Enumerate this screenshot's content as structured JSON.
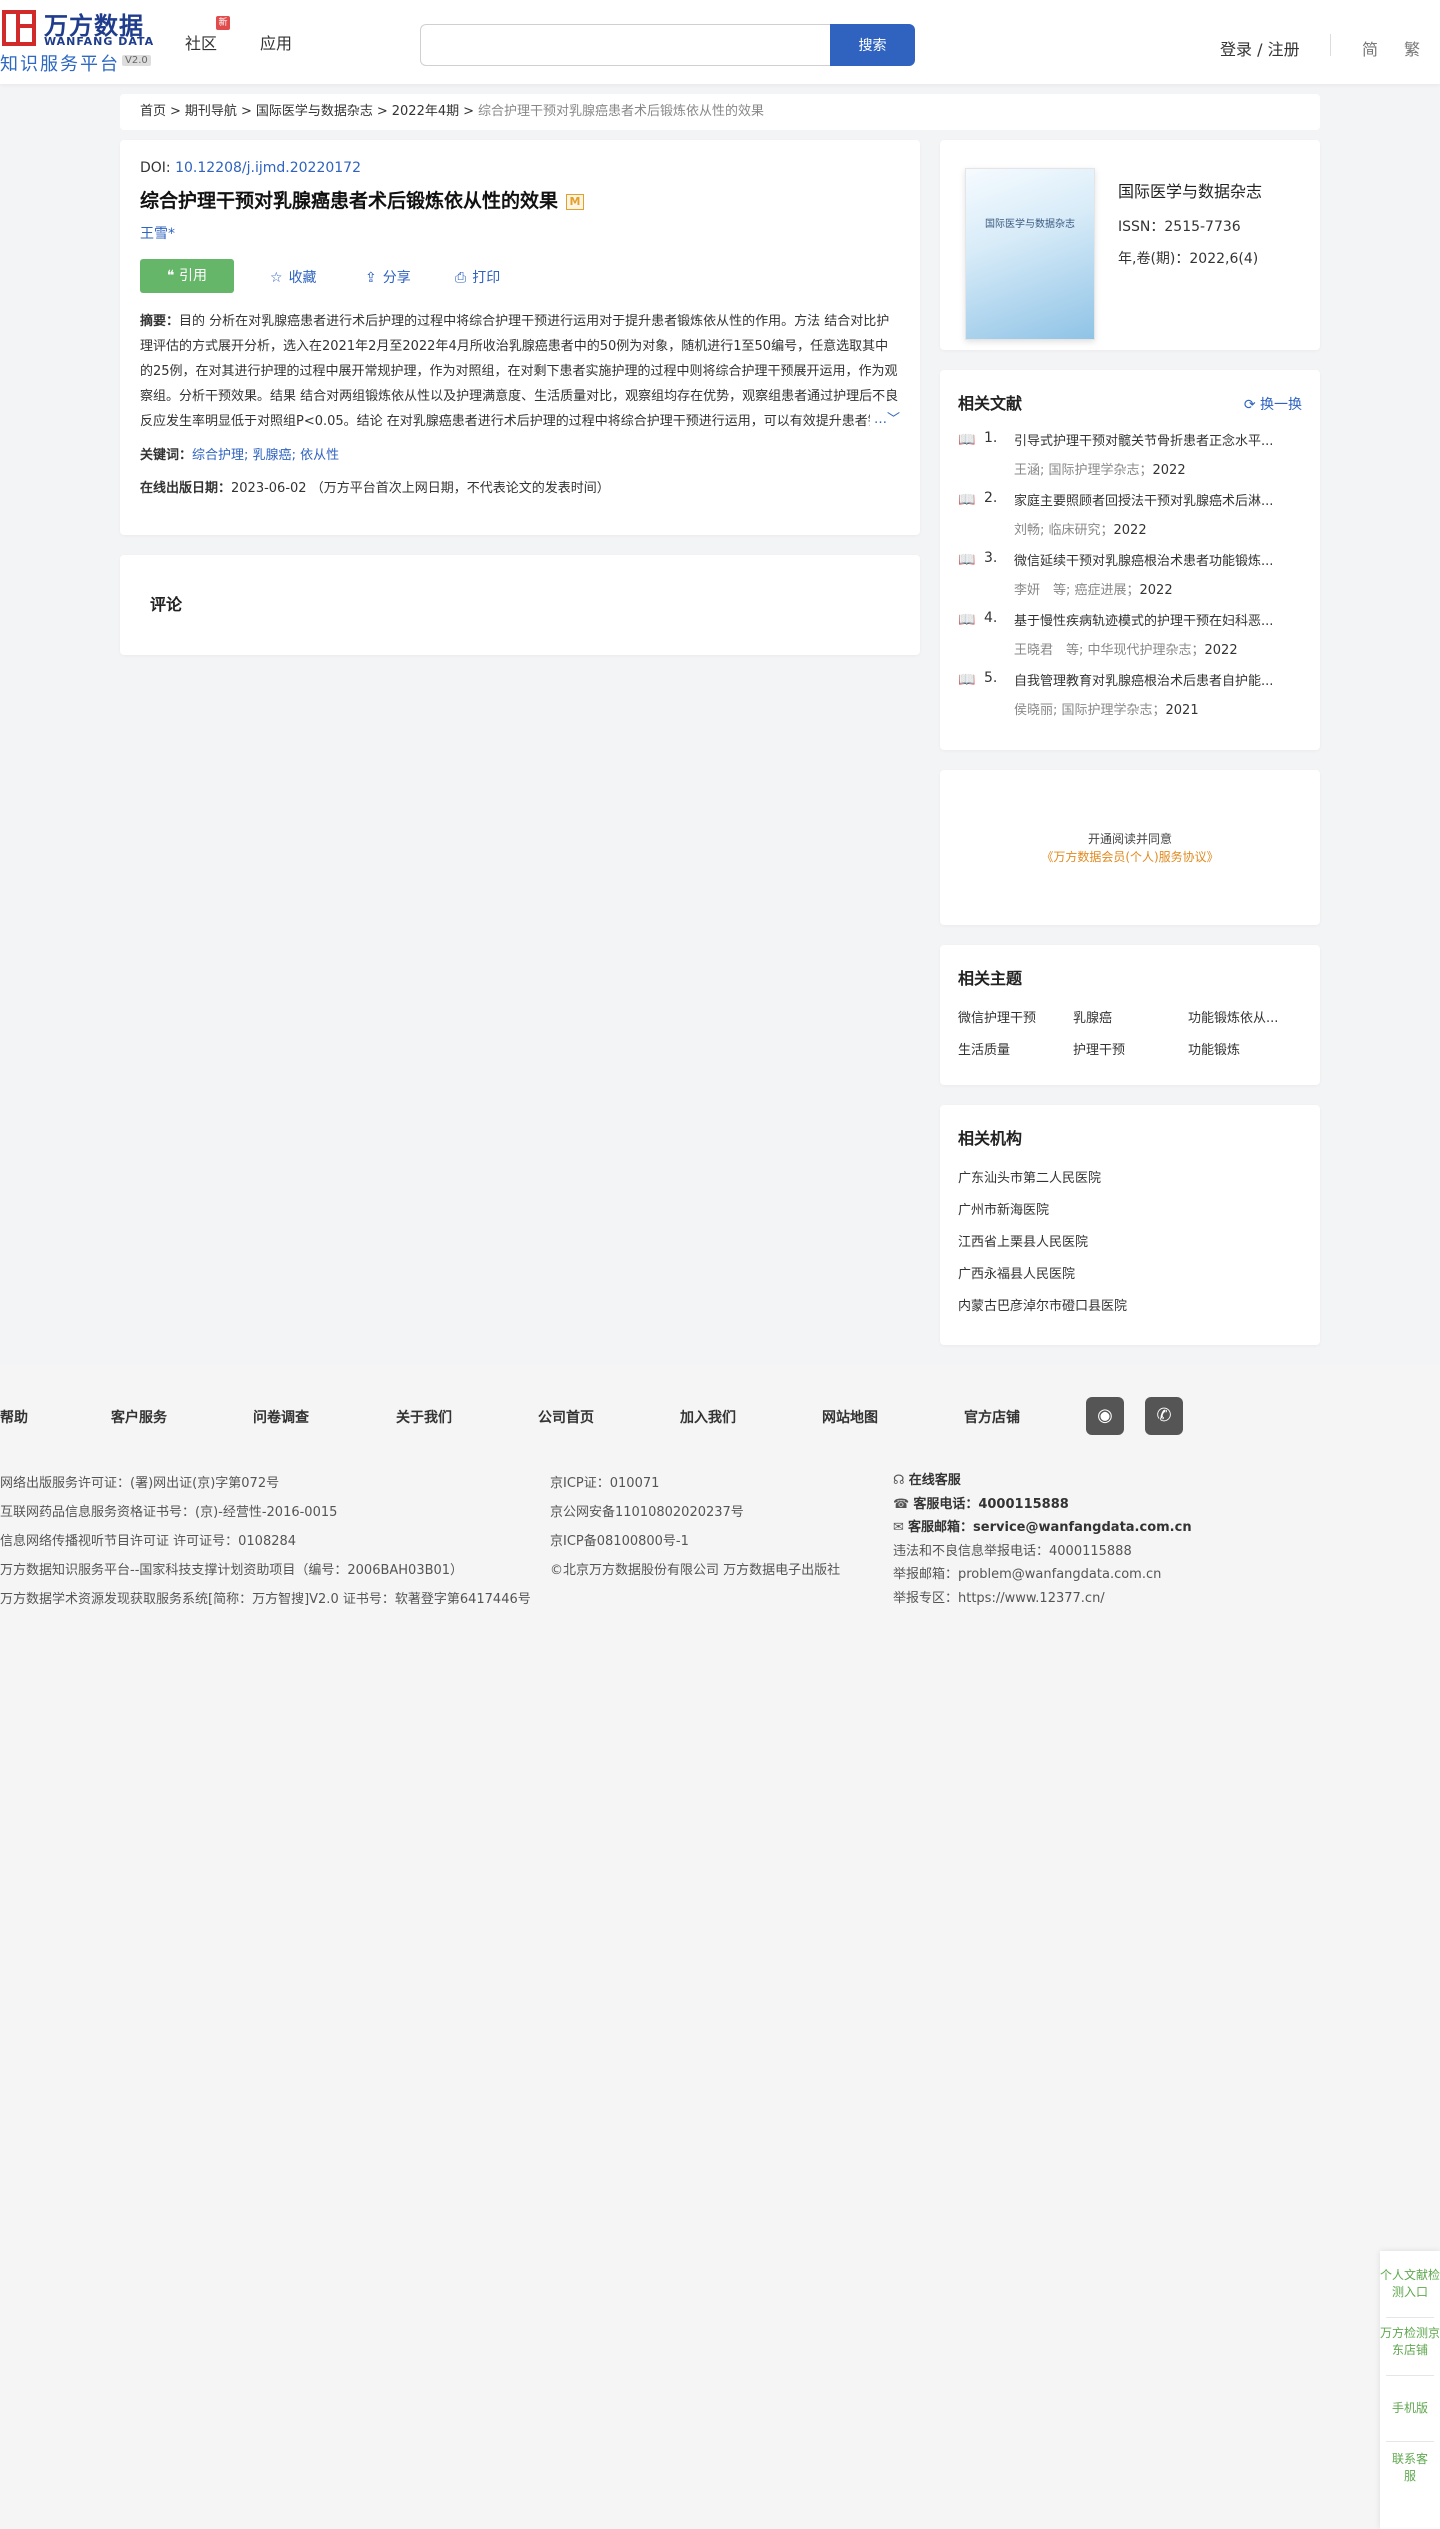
{
  "header": {
    "logo_cn": "万方数据",
    "logo_en": "WANFANG DATA",
    "logo_sub": "知识服务平台",
    "logo_ver": "V2.0",
    "nav": [
      "社区",
      "应用"
    ],
    "nav_badge": "新",
    "search_placeholder": "",
    "search_button": "搜索",
    "login": "登录 / 注册",
    "lang_simplified": "简",
    "lang_traditional": "繁"
  },
  "breadcrumb": {
    "items": [
      "首页",
      "期刊导航",
      "国际医学与数据杂志",
      "2022年4期"
    ],
    "current": "综合护理干预对乳腺癌患者术后锻炼依从性的效果",
    "sep": ">"
  },
  "article": {
    "doi_label": "DOI: ",
    "doi": "10.12208/j.ijmd.20220172",
    "title": "综合护理干预对乳腺癌患者术后锻炼依从性的效果",
    "badge": "M",
    "author": "王雪*",
    "actions": {
      "cite": "引用",
      "favorite": "收藏",
      "share": "分享",
      "print": "打印"
    },
    "abstract_label": "摘要：",
    "abstract": "目的 分析在对乳腺癌患者进行术后护理的过程中将综合护理干预进行运用对于提升患者锻炼依从性的作用。方法 结合对比护理评估的方式展开分析，选入在2021年2月至2022年4月所收治乳腺癌患者中的50例为对象，随机进行1至50编号，任意选取其中的25例，在对其进行护理的过程中展开常规护理，作为对照组，在对剩下患者实施护理的过程中则将综合护理干预展开运用，作为观察组。分析干预效果。结果 结合对两组锻炼依从性以及护理满意度、生活质量对比，观察组均存在优势，观察组患者通过护理后不良反应发生率明显低于对照组P<0.05。结论 在对乳腺癌患者进行术后护理的过程中将综合护理干预进行运用，可以有效提升患者锻炼依从性。",
    "keywords_label": "关键词：",
    "keywords": [
      "综合护理",
      "乳腺癌",
      "依从性"
    ],
    "pubdate_label": "在线出版日期：",
    "pubdate": "2023-06-02",
    "pubdate_note": "（万方平台首次上网日期，不代表论文的发表时间）"
  },
  "comment": {
    "title": "评论"
  },
  "journal": {
    "cover_title": "国际医学与数据杂志",
    "name": "国际医学与数据杂志",
    "issn": "ISSN：2515-7736",
    "volume": "年,卷(期)：2022,6(4)"
  },
  "related_literature": {
    "title": "相关文献",
    "refresh": "换一换",
    "items": [
      {
        "num": "1.",
        "title": "引导式护理干预对髋关节骨折患者正念水平...",
        "meta": "王涵; 国际护理学杂志；",
        "year": "2022"
      },
      {
        "num": "2.",
        "title": "家庭主要照顾者回授法干预对乳腺癌术后淋...",
        "meta": "刘畅; 临床研究；",
        "year": "2022"
      },
      {
        "num": "3.",
        "title": "微信延续干预对乳腺癌根治术患者功能锻炼...",
        "meta": "李妍　等; 癌症进展；",
        "year": "2022"
      },
      {
        "num": "4.",
        "title": "基于慢性疾病轨迹模式的护理干预在妇科恶...",
        "meta": "王晓君　等; 中华现代护理杂志；",
        "year": "2022"
      },
      {
        "num": "5.",
        "title": "自我管理教育对乳腺癌根治术后患者自护能...",
        "meta": "侯晓丽; 国际护理学杂志；",
        "year": "2021"
      }
    ]
  },
  "ad": {
    "line1": "开通阅读并同意",
    "line2": "《万方数据会员(个人)服务协议》"
  },
  "related_topics": {
    "title": "相关主题",
    "items": [
      "微信护理干预",
      "乳腺癌",
      "功能锻炼依从...",
      "生活质量",
      "护理干预",
      "功能锻炼"
    ]
  },
  "related_orgs": {
    "title": "相关机构",
    "items": [
      "广东汕头市第二人民医院",
      "广州市新海医院",
      "江西省上栗县人民医院",
      "广西永福县人民医院",
      "内蒙古巴彦淖尔市磴口县医院"
    ]
  },
  "footer": {
    "nav": [
      "帮助",
      "客户服务",
      "问卷调查",
      "关于我们",
      "公司首页",
      "加入我们",
      "网站地图",
      "官方店铺"
    ],
    "left": [
      "网络出版服务许可证：(署)网出证(京)字第072号",
      "互联网药品信息服务资格证书号：(京)-经营性-2016-0015",
      "信息网络传播视听节目许可证 许可证号：0108284",
      "万方数据知识服务平台--国家科技支撑计划资助项目（编号：2006BAH03B01）",
      "万方数据学术资源发现获取服务系统[简称：万方智搜]V2.0 证书号：软著登字第6417446号"
    ],
    "middle": [
      "京ICP证：010071",
      "京公网安备11010802020237号",
      "京ICP备08100800号-1",
      "©北京万方数据股份有限公司 万方数据电子出版社"
    ],
    "online_service": "在线客服",
    "phone_label": "客服电话：",
    "phone": "4000115888",
    "email_label": "客服邮箱：",
    "email": "service@wanfangdata.com.cn",
    "report_phone": "违法和不良信息举报电话：4000115888",
    "report_email": "举报邮箱：problem@wanfangdata.com.cn",
    "report_zone": "举报专区：https://www.12377.cn/"
  },
  "side_float": {
    "items": [
      "个人文献检测入口",
      "万方检测京东店铺",
      "手机版",
      "联系客服"
    ]
  }
}
